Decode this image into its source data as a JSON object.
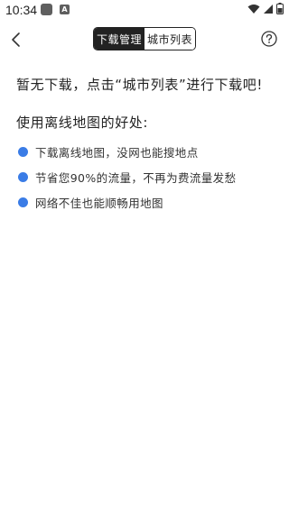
{
  "status_bar": {
    "time": "10:34",
    "notification_icons": [
      "square-app-icon",
      "font-a-icon"
    ],
    "notification_badge_text": "A",
    "system_icons": [
      "wifi-icon",
      "signal-icon",
      "battery-icon"
    ]
  },
  "toolbar": {
    "back_icon": "chevron-left-icon",
    "help_icon": "question-circle-icon",
    "tabs": [
      {
        "label": "下载管理",
        "active": true
      },
      {
        "label": "城市列表",
        "active": false
      }
    ]
  },
  "main": {
    "empty_message": "暂无下载，点击“城市列表”进行下载吧!",
    "benefits_title": "使用离线地图的好处:",
    "benefits": [
      "下载离线地图，没网也能搜地点",
      "节省您90%的流量，不再为费流量发愁",
      "网络不佳也能顺畅用地图"
    ]
  },
  "colors": {
    "accent_dot": "#3a7ce6",
    "tab_active_bg": "#222222",
    "text": "#222222"
  }
}
